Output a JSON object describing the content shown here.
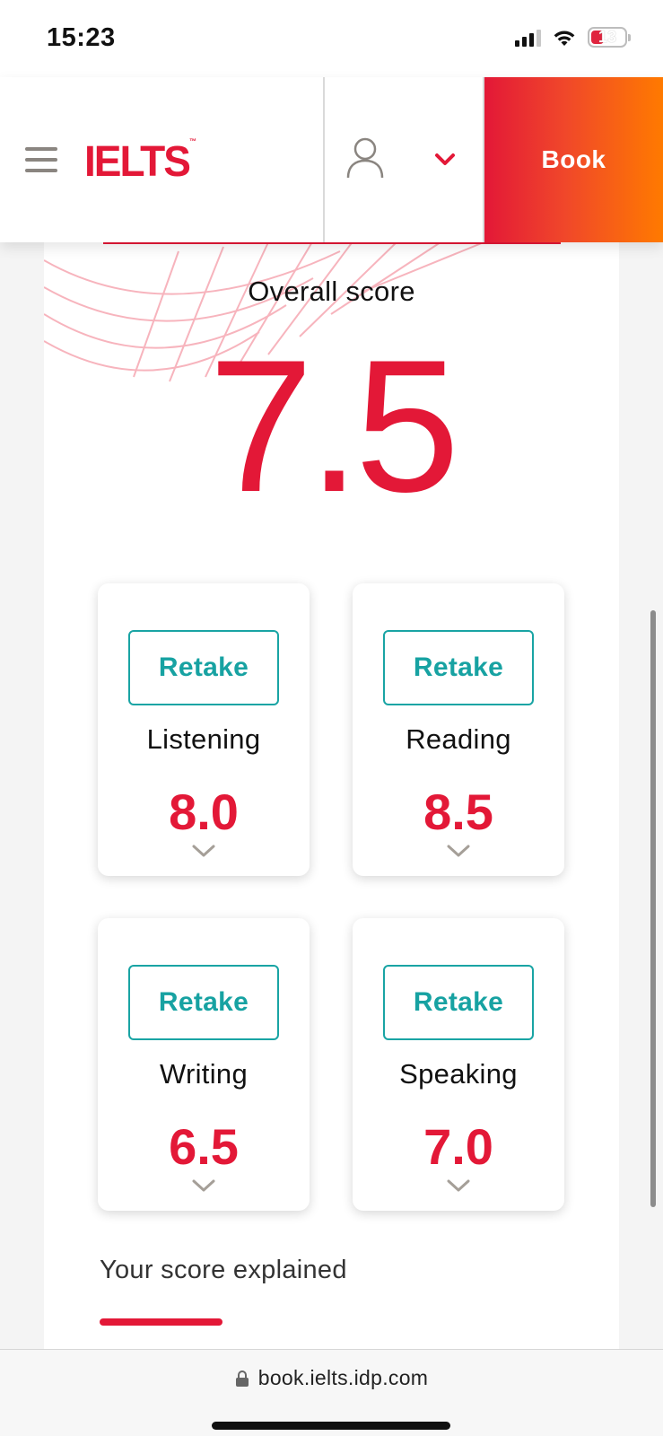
{
  "status_bar": {
    "time": "15:23",
    "battery_level": "13",
    "icons": [
      "signal-icon",
      "wifi-icon",
      "battery-icon"
    ]
  },
  "header": {
    "logo_text": "IELTS",
    "logo_tm": "™",
    "book_label": "Book",
    "icons": [
      "menu-icon",
      "user-icon",
      "chevron-down-icon"
    ]
  },
  "results": {
    "overall_label": "Overall score",
    "overall_score": "7.5",
    "sections": [
      {
        "name": "Listening",
        "score": "8.0",
        "retake_label": "Retake"
      },
      {
        "name": "Reading",
        "score": "8.5",
        "retake_label": "Retake"
      },
      {
        "name": "Writing",
        "score": "6.5",
        "retake_label": "Retake"
      },
      {
        "name": "Speaking",
        "score": "7.0",
        "retake_label": "Retake"
      }
    ],
    "explained_label": "Your score explained"
  },
  "browser": {
    "url": "book.ielts.idp.com"
  },
  "colors": {
    "brand_red": "#e31837",
    "teal": "#17a2a2",
    "book_gradient_end": "#ff7a00"
  }
}
